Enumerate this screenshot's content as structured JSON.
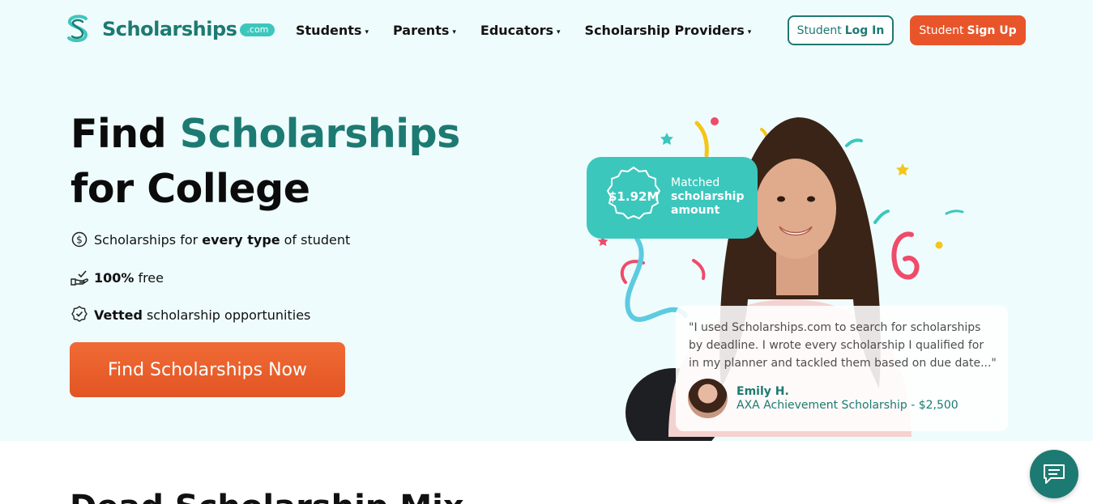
{
  "header": {
    "logo_text": "Scholarships",
    "logo_suffix": ".com",
    "nav": [
      {
        "label": "Students"
      },
      {
        "label": "Parents"
      },
      {
        "label": "Educators"
      },
      {
        "label": "Scholarship Providers"
      }
    ],
    "nav_caret": "▾",
    "login": {
      "prefix": "Student",
      "bold": "Log In"
    },
    "signup": {
      "prefix": "Student",
      "bold": "Sign Up"
    }
  },
  "hero": {
    "title_line1_plain": "Find",
    "title_line1_accent": "Scholarships",
    "title_line2": "for College",
    "features": [
      {
        "icon": "dollar-circle-icon",
        "pre": "Scholarships for",
        "bold": "every type",
        "post": "of student"
      },
      {
        "icon": "hand-check-icon",
        "bold": "100%",
        "post": "free"
      },
      {
        "icon": "award-badge-icon",
        "bold": "Vetted",
        "post": "scholarship opportunities"
      }
    ],
    "cta": "Find Scholarships Now"
  },
  "badge": {
    "amount": "$1.92M",
    "label_line1": "Matched",
    "label_line2": "scholarship",
    "label_line3": "amount"
  },
  "testimonial": {
    "quote": "\"I used Scholarships.com to search for scholarships by deadline. I wrote every scholarship I qualified for in my planner and tackled them based on due date...\"",
    "name": "Emily H.",
    "award": "AXA Achievement Scholarship - $2,500"
  },
  "lower_section": {
    "title": "Dead Scholarship Mix"
  },
  "colors": {
    "brand_teal": "#1d7a72",
    "accent_teal": "#3cc7bd",
    "cta_orange": "#e8552a",
    "hero_bg": "#effcfd"
  }
}
